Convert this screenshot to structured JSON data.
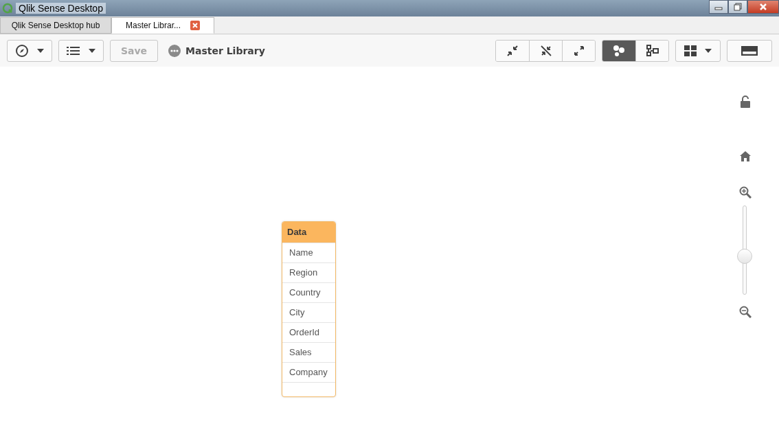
{
  "window": {
    "title": "Qlik Sense Desktop"
  },
  "tabs": [
    {
      "label": "Qlik Sense Desktop hub",
      "selected": false,
      "closable": false
    },
    {
      "label": "Master Librar...",
      "selected": true,
      "closable": true
    }
  ],
  "toolbar": {
    "save": {
      "label": "Save",
      "disabled": true
    },
    "app_title": "Master Library",
    "view_modes": [
      {
        "kind": "bubbles",
        "selected": true
      },
      {
        "kind": "tables",
        "selected": false
      }
    ]
  },
  "canvas": {
    "table": {
      "name": "Data",
      "fields": [
        "Name",
        "Region",
        "Country",
        "City",
        "OrderId",
        "Sales",
        "Company"
      ]
    },
    "zoom": {
      "level": 0.42
    }
  }
}
